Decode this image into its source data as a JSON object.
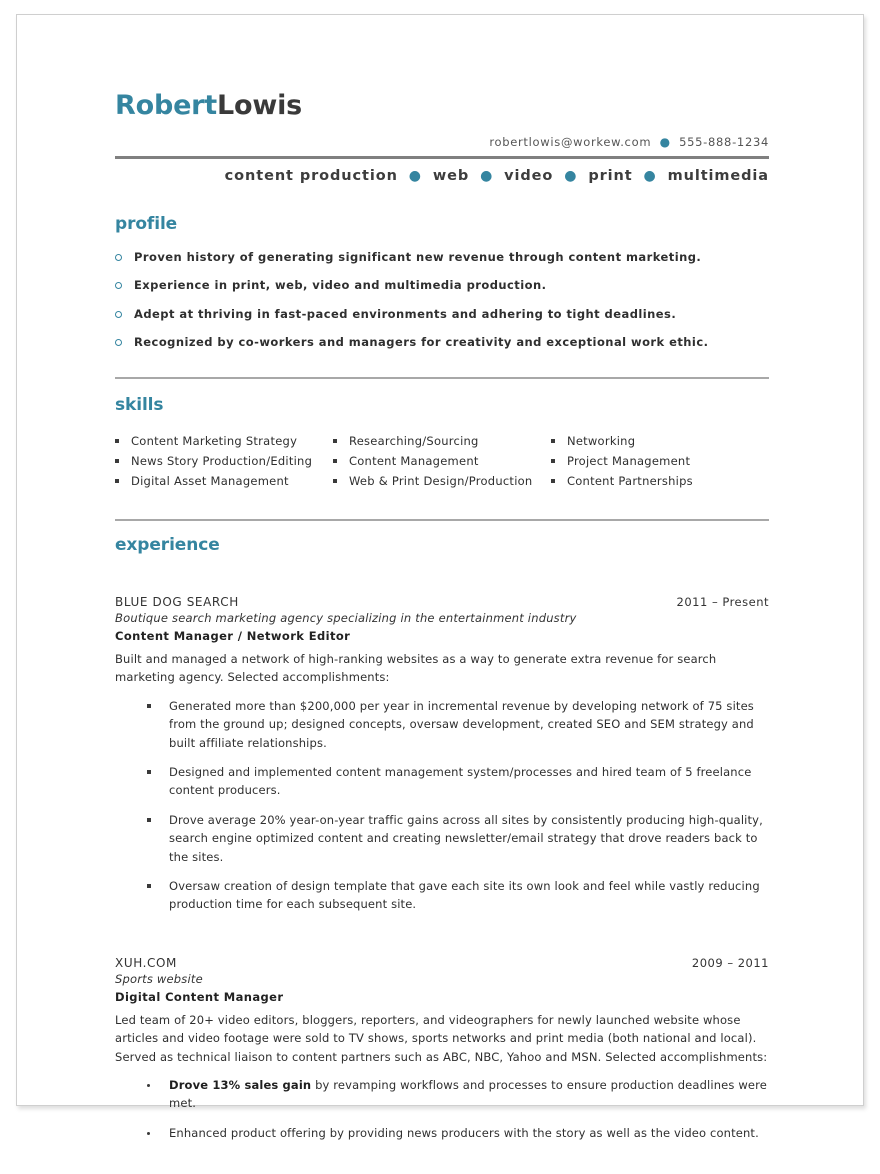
{
  "header": {
    "name_first": "Robert",
    "name_last": "Lowis",
    "email": "robertlowis@workew.com",
    "phone": "555-888-1234",
    "separator": "●",
    "tagline_parts": [
      "content production",
      "web",
      "video",
      "print",
      "multimedia"
    ],
    "accent_color": "#3585a0",
    "rule_color": "#808080"
  },
  "sections": {
    "profile": {
      "heading": "profile",
      "items": [
        "Proven history of generating significant new revenue through content marketing.",
        "Experience in print, web, video and multimedia production.",
        "Adept at thriving in fast-paced environments and adhering to tight deadlines.",
        "Recognized by co-workers and managers for creativity and exceptional work ethic."
      ]
    },
    "skills": {
      "heading": "skills",
      "columns": [
        [
          "Content Marketing Strategy",
          "News Story Production/Editing",
          "Digital Asset Management"
        ],
        [
          "Researching/Sourcing",
          "Content Management",
          "Web & Print Design/Production"
        ],
        [
          "Networking",
          "Project Management",
          "Content Partnerships"
        ]
      ]
    },
    "experience": {
      "heading": "experience",
      "jobs": [
        {
          "company": "BLUE DOG SEARCH",
          "dates": "2011 – Present",
          "tagline": "Boutique search marketing agency specializing in the entertainment industry",
          "title": "Content Manager / Network Editor",
          "description": "Built and managed a network of high-ranking websites as a way to generate extra revenue for search marketing agency. Selected accomplishments:",
          "bullet_style": "square",
          "accomplishments": [
            "Generated more than $200,000 per year in incremental revenue by developing network of 75 sites from the ground up; designed concepts, oversaw development, created SEO and SEM strategy and built affiliate relationships.",
            "Designed and implemented content management system/processes and hired team of 5 freelance content producers.",
            "Drove average 20% year-on-year traffic gains across all sites by consistently producing high-quality, search engine optimized content and creating newsletter/email strategy that drove readers back to the sites.",
            "Oversaw creation of design template that gave each site its own look and feel while vastly reducing production time for each subsequent site."
          ]
        },
        {
          "company": "XUH.COM",
          "dates": "2009 – 2011",
          "tagline": "Sports website",
          "title": "Digital Content Manager",
          "description": "Led team of 20+ video editors, bloggers, reporters, and videographers for newly launched website whose articles and video footage were sold to TV shows, sports networks and print media (both national and local). Served as technical liaison to content partners such as ABC, NBC, Yahoo and MSN. Selected accomplishments:",
          "bullet_style": "dot",
          "accomplishments": [
            "<b>Drove 13% sales gain</b> by revamping workflows and processes to ensure production deadlines were met.",
            "Enhanced product offering by providing news producers with the story as well as the video content."
          ]
        }
      ]
    }
  }
}
